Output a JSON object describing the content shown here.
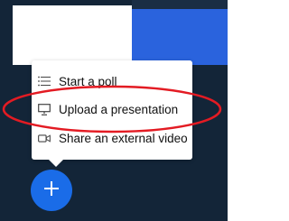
{
  "colors": {
    "background": "#132538",
    "presentation_area": "#2a63dd",
    "menu_background": "#ffffff",
    "action_button": "#1a6ce8",
    "annotation_ellipse": "#e31b23"
  },
  "actions_menu": {
    "items": [
      {
        "label": "Start a poll",
        "icon": "poll-list-icon"
      },
      {
        "label": "Upload a presentation",
        "icon": "presentation-icon"
      },
      {
        "label": "Share an external video",
        "icon": "video-camera-icon"
      }
    ]
  },
  "actions_button": {
    "icon": "plus-icon"
  },
  "annotation": {
    "shape": "ellipse",
    "highlights": "Upload a presentation"
  }
}
